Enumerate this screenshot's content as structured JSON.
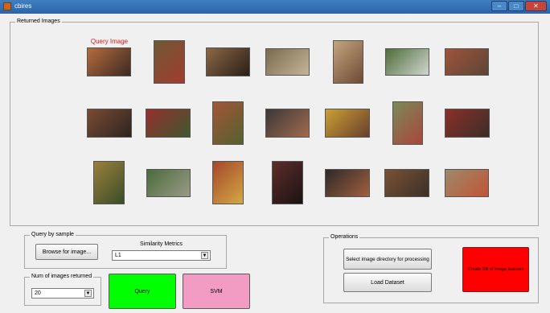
{
  "window": {
    "title": "cbires",
    "minimize": "–",
    "maximize": "□",
    "close": "✕"
  },
  "returned_images": {
    "panel_title": "Returned Images",
    "query_label": "Query Image",
    "thumbnails": [
      {
        "name": "thumb-query",
        "colors": [
          "#b56b3d",
          "#3b2a22"
        ]
      },
      {
        "name": "thumb-1-2",
        "colors": [
          "#6e5a35",
          "#a23b2e"
        ]
      },
      {
        "name": "thumb-1-3",
        "colors": [
          "#8b6845",
          "#2a1e17"
        ]
      },
      {
        "name": "thumb-1-4",
        "colors": [
          "#7a6a4d",
          "#c4b59a"
        ]
      },
      {
        "name": "thumb-1-5",
        "colors": [
          "#c3a57e",
          "#6e4a35"
        ]
      },
      {
        "name": "thumb-1-6",
        "colors": [
          "#4f6d3a",
          "#d0d6cf"
        ]
      },
      {
        "name": "thumb-1-7",
        "colors": [
          "#a0533b",
          "#5b4636"
        ]
      },
      {
        "name": "thumb-2-1",
        "colors": [
          "#7b4b34",
          "#2d2420"
        ]
      },
      {
        "name": "thumb-2-2",
        "colors": [
          "#96302b",
          "#3e5732"
        ]
      },
      {
        "name": "thumb-2-3",
        "colors": [
          "#a45538",
          "#54612f"
        ]
      },
      {
        "name": "thumb-2-4",
        "colors": [
          "#3a3838",
          "#a26a4f"
        ]
      },
      {
        "name": "thumb-2-5",
        "colors": [
          "#c9a032",
          "#693f2e"
        ]
      },
      {
        "name": "thumb-2-6",
        "colors": [
          "#7b8a5a",
          "#a8463a"
        ]
      },
      {
        "name": "thumb-2-7",
        "colors": [
          "#8d2f2a",
          "#3a2d26"
        ]
      },
      {
        "name": "thumb-3-1",
        "colors": [
          "#9b7f3b",
          "#3a4d28"
        ]
      },
      {
        "name": "thumb-3-2",
        "colors": [
          "#4a6b3b",
          "#9a9a86"
        ]
      },
      {
        "name": "thumb-3-3",
        "colors": [
          "#a5472b",
          "#d3a845"
        ]
      },
      {
        "name": "thumb-3-4",
        "colors": [
          "#5e2d2a",
          "#1a1313"
        ]
      },
      {
        "name": "thumb-3-5",
        "colors": [
          "#2d2a28",
          "#a15f40"
        ]
      },
      {
        "name": "thumb-3-6",
        "colors": [
          "#7a5235",
          "#3b3028"
        ]
      },
      {
        "name": "thumb-3-7",
        "colors": [
          "#9b8a6a",
          "#c25436"
        ]
      }
    ]
  },
  "query_by_sample": {
    "panel_title": "Query by sample",
    "browse_button": "Browse for image...",
    "metrics_label": "Similarity Metrics",
    "metrics_value": "L1"
  },
  "num_images": {
    "panel_title": "Num of images returned",
    "value": "20"
  },
  "query_button": {
    "label": "Query",
    "color": "#00ff00"
  },
  "svm_button": {
    "label": "SVM",
    "color": "#f29bc3"
  },
  "operations": {
    "panel_title": "Operations",
    "select_dir_button": "Select image directory for processing",
    "load_dataset_button": "Load Dataset",
    "create_db_button": "Create DB of image features",
    "create_db_color": "#ff0000"
  },
  "dropdown_arrow": "▼"
}
